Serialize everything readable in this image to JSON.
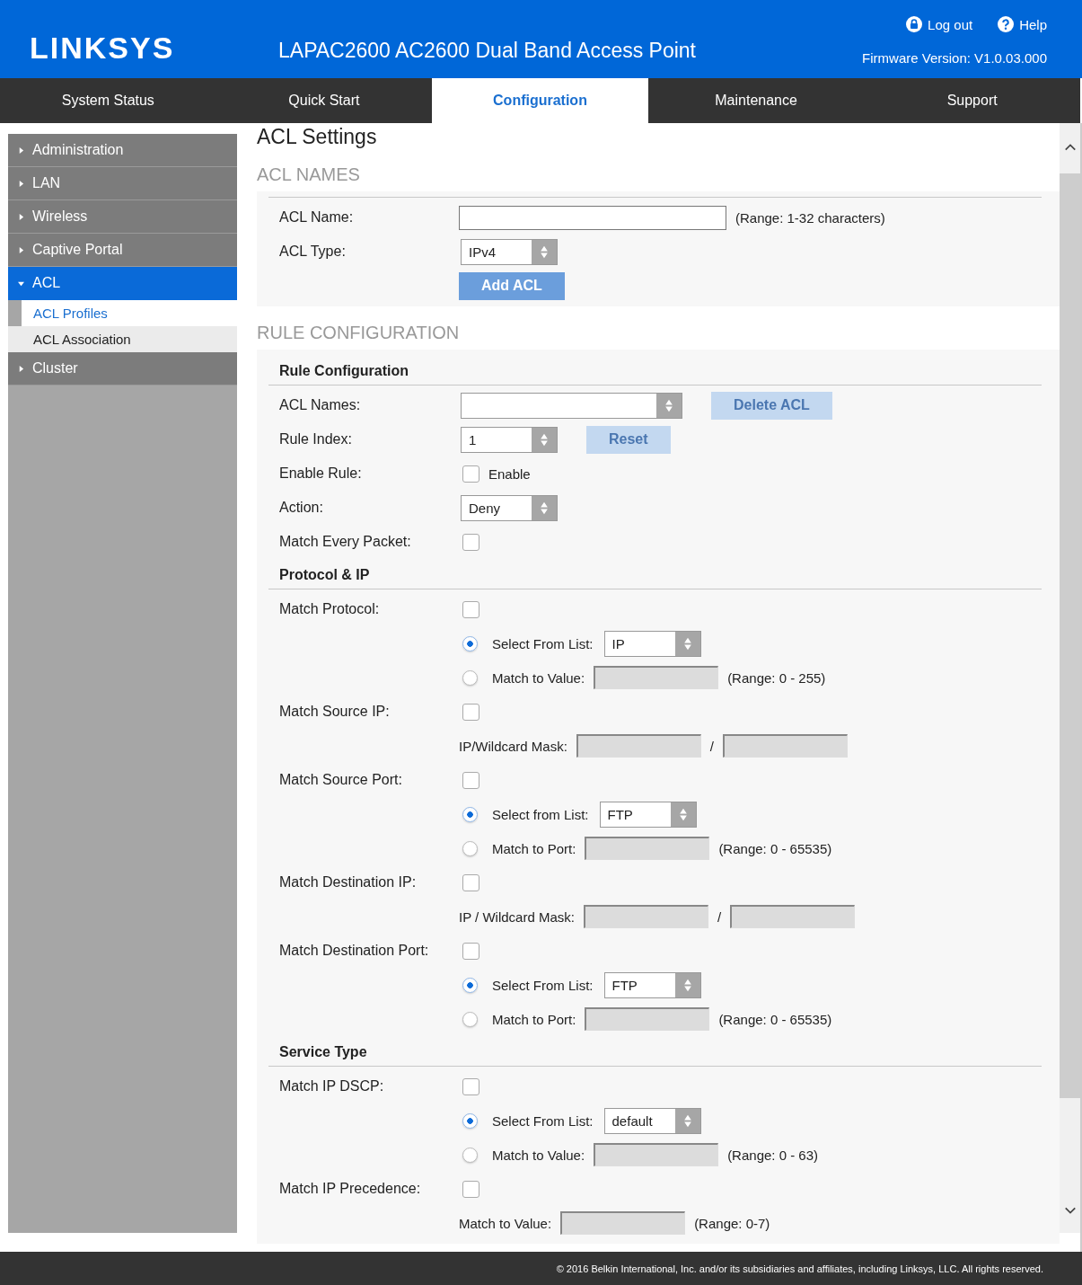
{
  "header": {
    "logo": "LINKSYS",
    "title": "LAPAC2600 AC2600 Dual Band Access Point",
    "links": [
      {
        "kind": "logout",
        "label": "Log out"
      },
      {
        "kind": "help",
        "label": "Help"
      }
    ],
    "firmware": "Firmware Version: V1.0.03.000"
  },
  "tabs": [
    {
      "label": "System Status",
      "selected": false
    },
    {
      "label": "Quick Start",
      "selected": false
    },
    {
      "label": "Configuration",
      "selected": true
    },
    {
      "label": "Maintenance",
      "selected": false
    },
    {
      "label": "Support",
      "selected": false
    }
  ],
  "sidebar": [
    {
      "label": "Administration",
      "expanded": false,
      "selected": false
    },
    {
      "label": "LAN",
      "expanded": false,
      "selected": false
    },
    {
      "label": "Wireless",
      "expanded": false,
      "selected": false
    },
    {
      "label": "Captive Portal",
      "expanded": false,
      "selected": false
    },
    {
      "label": "ACL",
      "expanded": true,
      "selected": true,
      "children": [
        {
          "label": "ACL Profiles",
          "selected": true
        },
        {
          "label": "ACL Association",
          "selected": false
        }
      ]
    },
    {
      "label": "Cluster",
      "expanded": false,
      "selected": false
    }
  ],
  "page_title": "ACL Settings",
  "sections": [
    {
      "title": "ACL NAMES",
      "groups": [
        {
          "rows": [
            {
              "label": "ACL Name:",
              "controls": [
                {
                  "kind": "field",
                  "disabled": false
                },
                {
                  "kind": "text",
                  "text": "(Range: 1-32 characters)"
                }
              ]
            },
            {
              "label": "ACL Type:",
              "controls": [
                {
                  "kind": "select",
                  "value": "IPv4"
                }
              ]
            },
            {
              "controls": [
                {
                  "kind": "button",
                  "label": "Add ACL",
                  "disabled": false
                }
              ]
            }
          ]
        }
      ]
    },
    {
      "title": "RULE CONFIGURATION",
      "groups": [
        {
          "heading": "Rule Configuration",
          "rows": [
            {
              "label": "ACL Names:",
              "controls": [
                {
                  "kind": "select"
                },
                {
                  "kind": "button",
                  "label": "Delete ACL",
                  "disabled": true
                }
              ]
            },
            {
              "label": "Rule Index:",
              "controls": [
                {
                  "kind": "select",
                  "value": "1"
                },
                {
                  "kind": "button",
                  "label": "Reset",
                  "disabled": true
                }
              ]
            },
            {
              "label": "Enable Rule:",
              "controls": [
                {
                  "kind": "checkbox",
                  "checked": false
                },
                {
                  "kind": "text",
                  "text": "Enable"
                }
              ]
            },
            {
              "label": "Action:",
              "controls": [
                {
                  "kind": "select",
                  "value": "Deny"
                }
              ]
            },
            {
              "label": "Match Every Packet:",
              "controls": [
                {
                  "kind": "checkbox",
                  "checked": false
                }
              ]
            }
          ]
        },
        {
          "heading": "Protocol & IP",
          "rows": [
            {
              "label": "Match Protocol:",
              "controls": [
                {
                  "kind": "checkbox",
                  "checked": false
                }
              ]
            },
            {
              "controls": [
                {
                  "kind": "radio",
                  "selected": true
                },
                {
                  "kind": "text",
                  "text": "Select From List:"
                },
                {
                  "kind": "select",
                  "value": "IP"
                }
              ]
            },
            {
              "controls": [
                {
                  "kind": "radio",
                  "selected": false
                },
                {
                  "kind": "text",
                  "text": "Match to Value:"
                },
                {
                  "kind": "field",
                  "disabled": true
                },
                {
                  "kind": "text",
                  "text": "(Range: 0 - 255)"
                }
              ]
            },
            {
              "label": "Match Source IP:",
              "controls": [
                {
                  "kind": "checkbox",
                  "checked": false
                }
              ]
            },
            {
              "controls": [
                {
                  "kind": "text",
                  "text": "IP/Wildcard Mask:"
                },
                {
                  "kind": "field",
                  "disabled": true
                },
                {
                  "kind": "text",
                  "text": "/"
                },
                {
                  "kind": "field",
                  "disabled": true
                }
              ]
            },
            {
              "label": "Match Source Port:",
              "controls": [
                {
                  "kind": "checkbox",
                  "checked": false
                }
              ]
            },
            {
              "controls": [
                {
                  "kind": "radio",
                  "selected": true
                },
                {
                  "kind": "text",
                  "text": "Select from List:"
                },
                {
                  "kind": "select",
                  "value": "FTP"
                }
              ]
            },
            {
              "controls": [
                {
                  "kind": "radio",
                  "selected": false
                },
                {
                  "kind": "text",
                  "text": "Match to Port:"
                },
                {
                  "kind": "field",
                  "disabled": true
                },
                {
                  "kind": "text",
                  "text": "(Range: 0 - 65535)"
                }
              ]
            },
            {
              "label": "Match Destination IP:",
              "controls": [
                {
                  "kind": "checkbox",
                  "checked": false
                }
              ]
            },
            {
              "controls": [
                {
                  "kind": "text",
                  "text": "IP / Wildcard Mask:"
                },
                {
                  "kind": "field",
                  "disabled": true
                },
                {
                  "kind": "text",
                  "text": "/"
                },
                {
                  "kind": "field",
                  "disabled": true
                }
              ]
            },
            {
              "label": "Match Destination Port:",
              "controls": [
                {
                  "kind": "checkbox",
                  "checked": false
                }
              ]
            },
            {
              "controls": [
                {
                  "kind": "radio",
                  "selected": true
                },
                {
                  "kind": "text",
                  "text": "Select From List:"
                },
                {
                  "kind": "select",
                  "value": "FTP"
                }
              ]
            },
            {
              "controls": [
                {
                  "kind": "radio",
                  "selected": false
                },
                {
                  "kind": "text",
                  "text": "Match to Port:"
                },
                {
                  "kind": "field",
                  "disabled": true
                },
                {
                  "kind": "text",
                  "text": "(Range: 0 - 65535)"
                }
              ]
            }
          ]
        },
        {
          "heading": "Service Type",
          "rows": [
            {
              "label": "Match IP DSCP:",
              "controls": [
                {
                  "kind": "checkbox",
                  "checked": false
                }
              ]
            },
            {
              "controls": [
                {
                  "kind": "radio",
                  "selected": true
                },
                {
                  "kind": "text",
                  "text": "Select From List:"
                },
                {
                  "kind": "select",
                  "value": "default"
                }
              ]
            },
            {
              "controls": [
                {
                  "kind": "radio",
                  "selected": false
                },
                {
                  "kind": "text",
                  "text": "Match to Value:"
                },
                {
                  "kind": "field",
                  "disabled": true
                },
                {
                  "kind": "text",
                  "text": "(Range: 0 - 63)"
                }
              ]
            },
            {
              "label": "Match IP Precedence:",
              "controls": [
                {
                  "kind": "checkbox",
                  "checked": false
                }
              ]
            },
            {
              "controls": [
                {
                  "kind": "text",
                  "text": "Match to Value:"
                },
                {
                  "kind": "field",
                  "disabled": true
                },
                {
                  "kind": "text",
                  "text": "(Range: 0-7)"
                }
              ]
            }
          ]
        }
      ]
    }
  ],
  "footer": "© 2016 Belkin International, Inc. and/or its subsidiaries and affiliates, including Linksys, LLC. All rights reserved."
}
